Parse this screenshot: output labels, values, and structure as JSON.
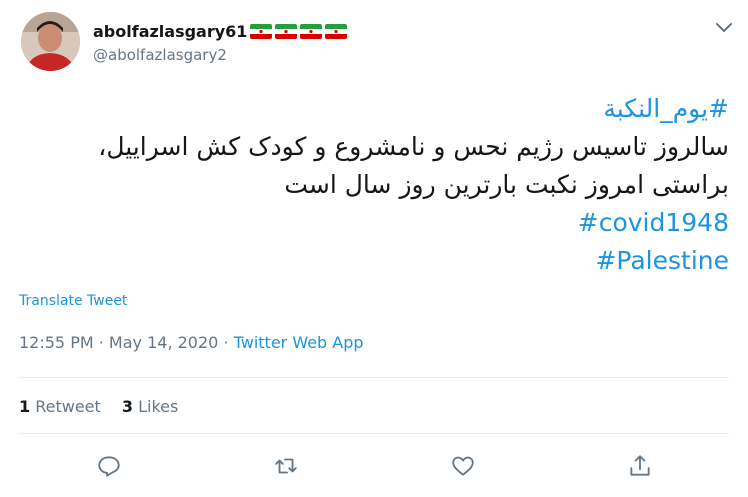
{
  "user": {
    "display_name": "abolfazlasgary61",
    "handle": "@abolfazlasgary2",
    "flags": [
      "iran-flag-icon",
      "iran-flag-icon",
      "iran-flag-icon",
      "iran-flag-icon"
    ]
  },
  "tweet": {
    "hashtag_top": "#یوم_النکبة",
    "line1": "سالروز تاسیس رژیم نحس و نامشروع و کودک کش اسراییل،",
    "line2": "براستی امروز نکبت بارترین روز سال است",
    "hashtag_covid": "#covid1948",
    "hashtag_palestine": "#Palestine"
  },
  "translate_label": "Translate Tweet",
  "meta": {
    "time": "12:55 PM",
    "separator1": " · ",
    "date": "May 14, 2020",
    "separator2": " · ",
    "source": "Twitter Web App"
  },
  "stats": {
    "retweets_count": "1",
    "retweets_label": " Retweet",
    "likes_count": "3",
    "likes_label": " Likes"
  },
  "actions": [
    "reply-icon",
    "retweet-icon",
    "like-icon",
    "share-icon"
  ],
  "colors": {
    "link": "#1b95e0",
    "muted": "#657786",
    "text": "#14171a",
    "divider": "#e6ecf0"
  }
}
